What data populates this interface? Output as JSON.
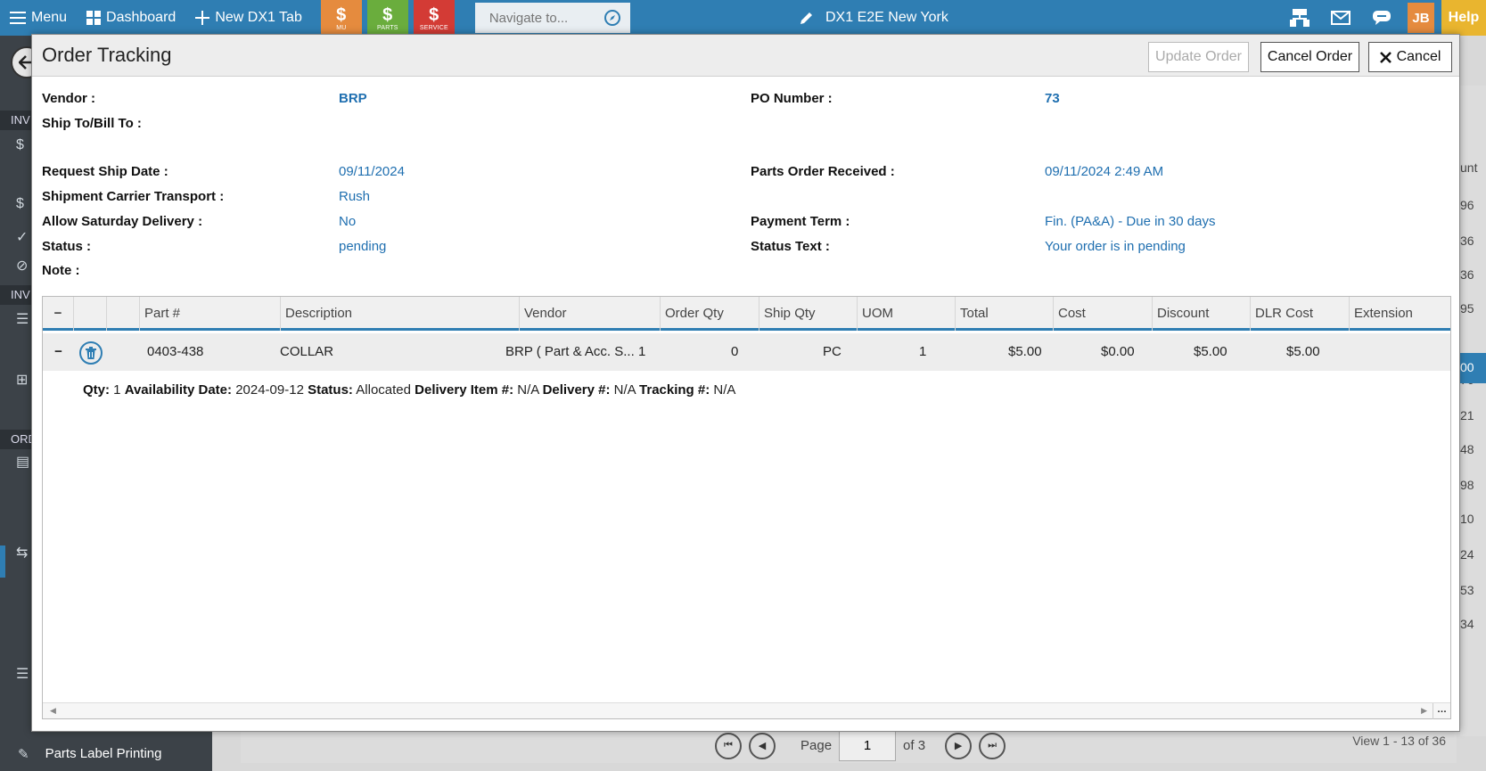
{
  "topbar": {
    "menu_label": "Menu",
    "dashboard_label": "Dashboard",
    "new_tab_label": "New DX1 Tab",
    "tiles": [
      {
        "glyph": "$",
        "label": "MU",
        "color": "#e58b3e"
      },
      {
        "glyph": "$",
        "label": "PARTS",
        "color": "#6aad3d"
      },
      {
        "glyph": "$",
        "label": "SERVICE",
        "color": "#d33b35"
      }
    ],
    "navigate_placeholder": "Navigate to...",
    "tab_title": "DX1 E2E New York",
    "user_initials": "JB",
    "help_label": "Help",
    "colors": {
      "bar": "#2f7eb3",
      "avatar": "#e58b3e",
      "help": "#e9b52f"
    }
  },
  "sidebar": {
    "headers": [
      "INV",
      "INV",
      "ORD"
    ],
    "bottom_item": "Parts Label Printing"
  },
  "background": {
    "right_column_header": "unt",
    "right_column_values": [
      "96",
      "36",
      "36",
      "95",
      "00",
      "76",
      "21",
      "48",
      "98",
      "10",
      "24",
      "53",
      "34"
    ],
    "pager": {
      "page_label": "Page",
      "page_value": "1",
      "of_label": "of 3",
      "view_text": "View 1 - 13 of 36"
    }
  },
  "modal": {
    "title": "Order Tracking",
    "buttons": {
      "update": "Update Order",
      "cancel_order": "Cancel Order",
      "cancel": "Cancel"
    },
    "fields": {
      "vendor_label": "Vendor :",
      "vendor_value": "BRP",
      "po_label": "PO Number :",
      "po_value": "73",
      "ship_to_label": "Ship To/Bill To :",
      "request_ship_date_label": "Request Ship Date :",
      "request_ship_date_value": "09/11/2024",
      "parts_order_received_label": "Parts Order Received :",
      "parts_order_received_value": "09/11/2024 2:49 AM",
      "shipment_carrier_label": "Shipment Carrier Transport :",
      "shipment_carrier_value": "Rush",
      "allow_saturday_label": "Allow Saturday Delivery :",
      "allow_saturday_value": "No",
      "payment_term_label": "Payment Term :",
      "payment_term_value": "Fin. (PA&A) - Due in 30 days",
      "status_label": "Status :",
      "status_value": "pending",
      "status_text_label": "Status Text :",
      "status_text_value": "Your order is in pending",
      "note_label": "Note :"
    },
    "grid": {
      "columns": [
        "Part #",
        "Description",
        "Vendor",
        "Order Qty",
        "Ship Qty",
        "UOM",
        "Total",
        "Cost",
        "Discount",
        "DLR Cost",
        "Extension"
      ],
      "row": {
        "part": "0403-438",
        "description": "COLLAR",
        "vendor": "BRP ( Part & Acc. S...",
        "order_qty": "1",
        "ship_qty": "0",
        "uom": "PC",
        "total": "1",
        "cost": "$5.00",
        "discount": "$0.00",
        "dlr_cost": "$5.00",
        "extension": "$5.00"
      },
      "detail": {
        "qty_label": "Qty:",
        "qty_value": "1",
        "availability_label": "Availability Date:",
        "availability_value": "2024-09-12",
        "status_label": "Status:",
        "status_value": "Allocated",
        "delivery_item_label": "Delivery Item #:",
        "delivery_item_value": "N/A",
        "delivery_label": "Delivery #:",
        "delivery_value": "N/A",
        "tracking_label": "Tracking #:",
        "tracking_value": "N/A"
      }
    }
  }
}
